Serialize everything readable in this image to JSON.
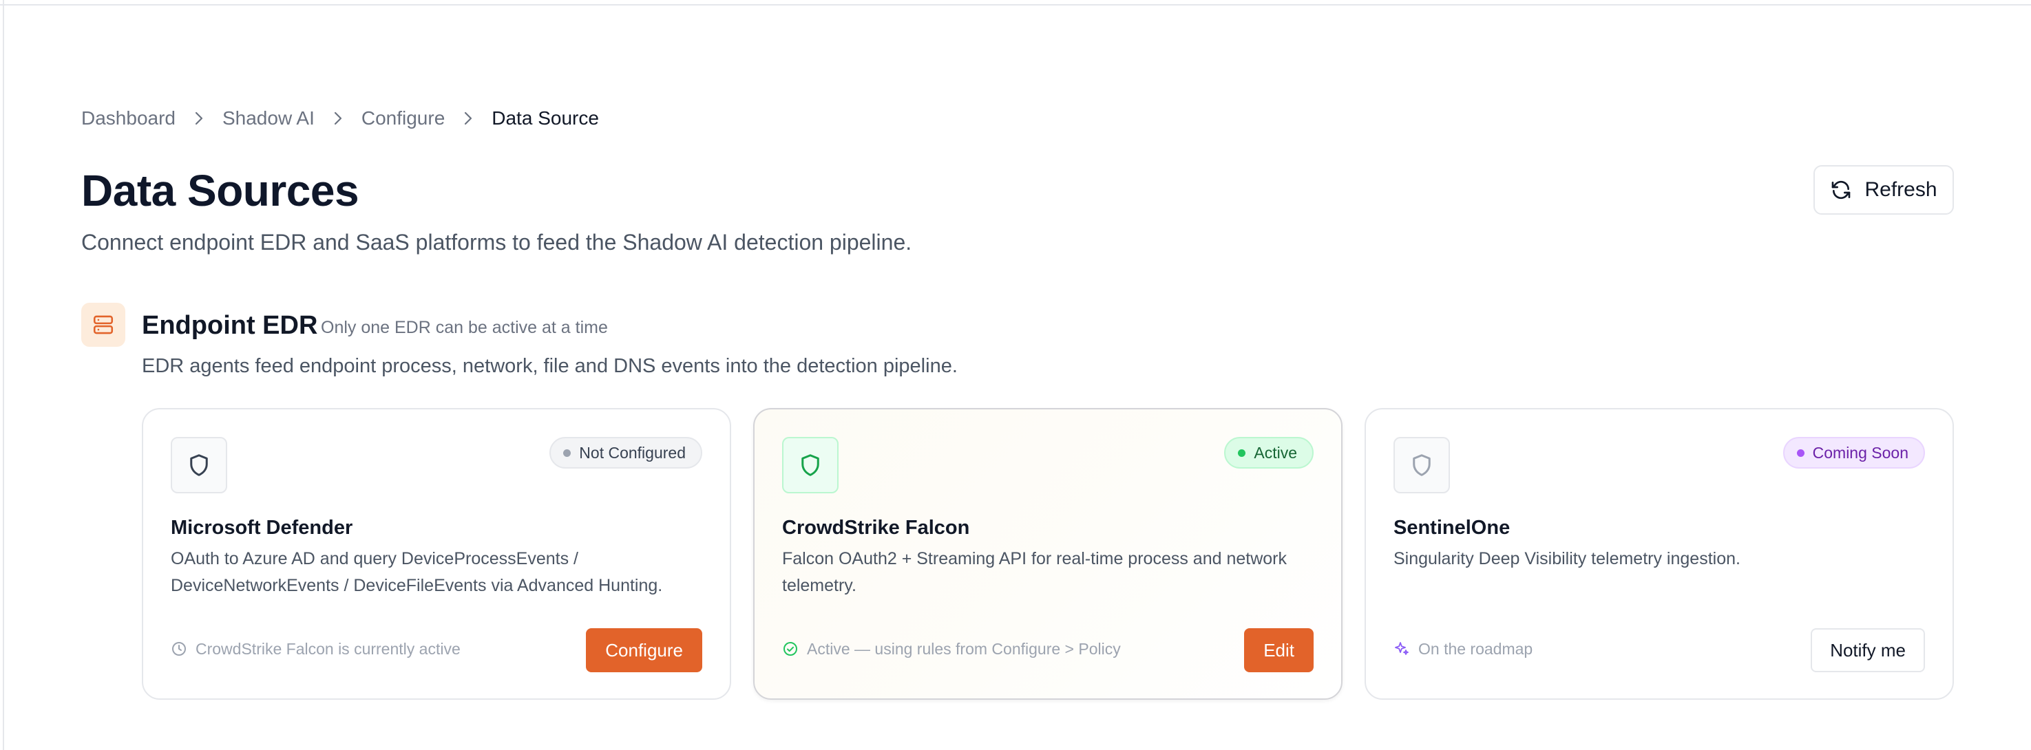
{
  "breadcrumb": [
    {
      "label": "Dashboard"
    },
    {
      "label": "Shadow AI"
    },
    {
      "label": "Configure"
    },
    {
      "label": "Data Source"
    }
  ],
  "page": {
    "title": "Data Sources",
    "subtitle": "Connect endpoint EDR and SaaS platforms to feed the Shadow AI detection pipeline.",
    "refresh_label": "Refresh",
    "refresh_icon": "refresh-icon"
  },
  "section": {
    "icon": "server-icon",
    "title": "Endpoint EDR",
    "note": "Only one EDR can be active at a time",
    "description": "EDR agents feed endpoint process, network, file and DNS events into the detection pipeline."
  },
  "cards": [
    {
      "icon": "shield-icon",
      "badge": "Not Configured",
      "title": "Microsoft Defender",
      "description": "OAuth to Azure AD and query DeviceProcessEvents / DeviceNetworkEvents / DeviceFileEvents via Advanced Hunting.",
      "status_icon": "clock-icon",
      "status": "CrowdStrike Falcon is currently active",
      "action": "Configure"
    },
    {
      "icon": "shield-icon",
      "badge": "Active",
      "title": "CrowdStrike Falcon",
      "description": "Falcon OAuth2 + Streaming API for real-time process and network telemetry.",
      "status_icon": "check-circle-icon",
      "status": "Active — using rules from Configure > Policy",
      "action": "Edit"
    },
    {
      "icon": "shield-icon",
      "badge": "Coming Soon",
      "title": "SentinelOne",
      "description": "Singularity Deep Visibility telemetry ingestion.",
      "status_icon": "sparkles-icon",
      "status": "On the roadmap",
      "action": "Notify me"
    }
  ],
  "colors": {
    "accent": "#e2632a",
    "active_green": "#22c55e",
    "coming_soon_purple": "#a855f7"
  }
}
